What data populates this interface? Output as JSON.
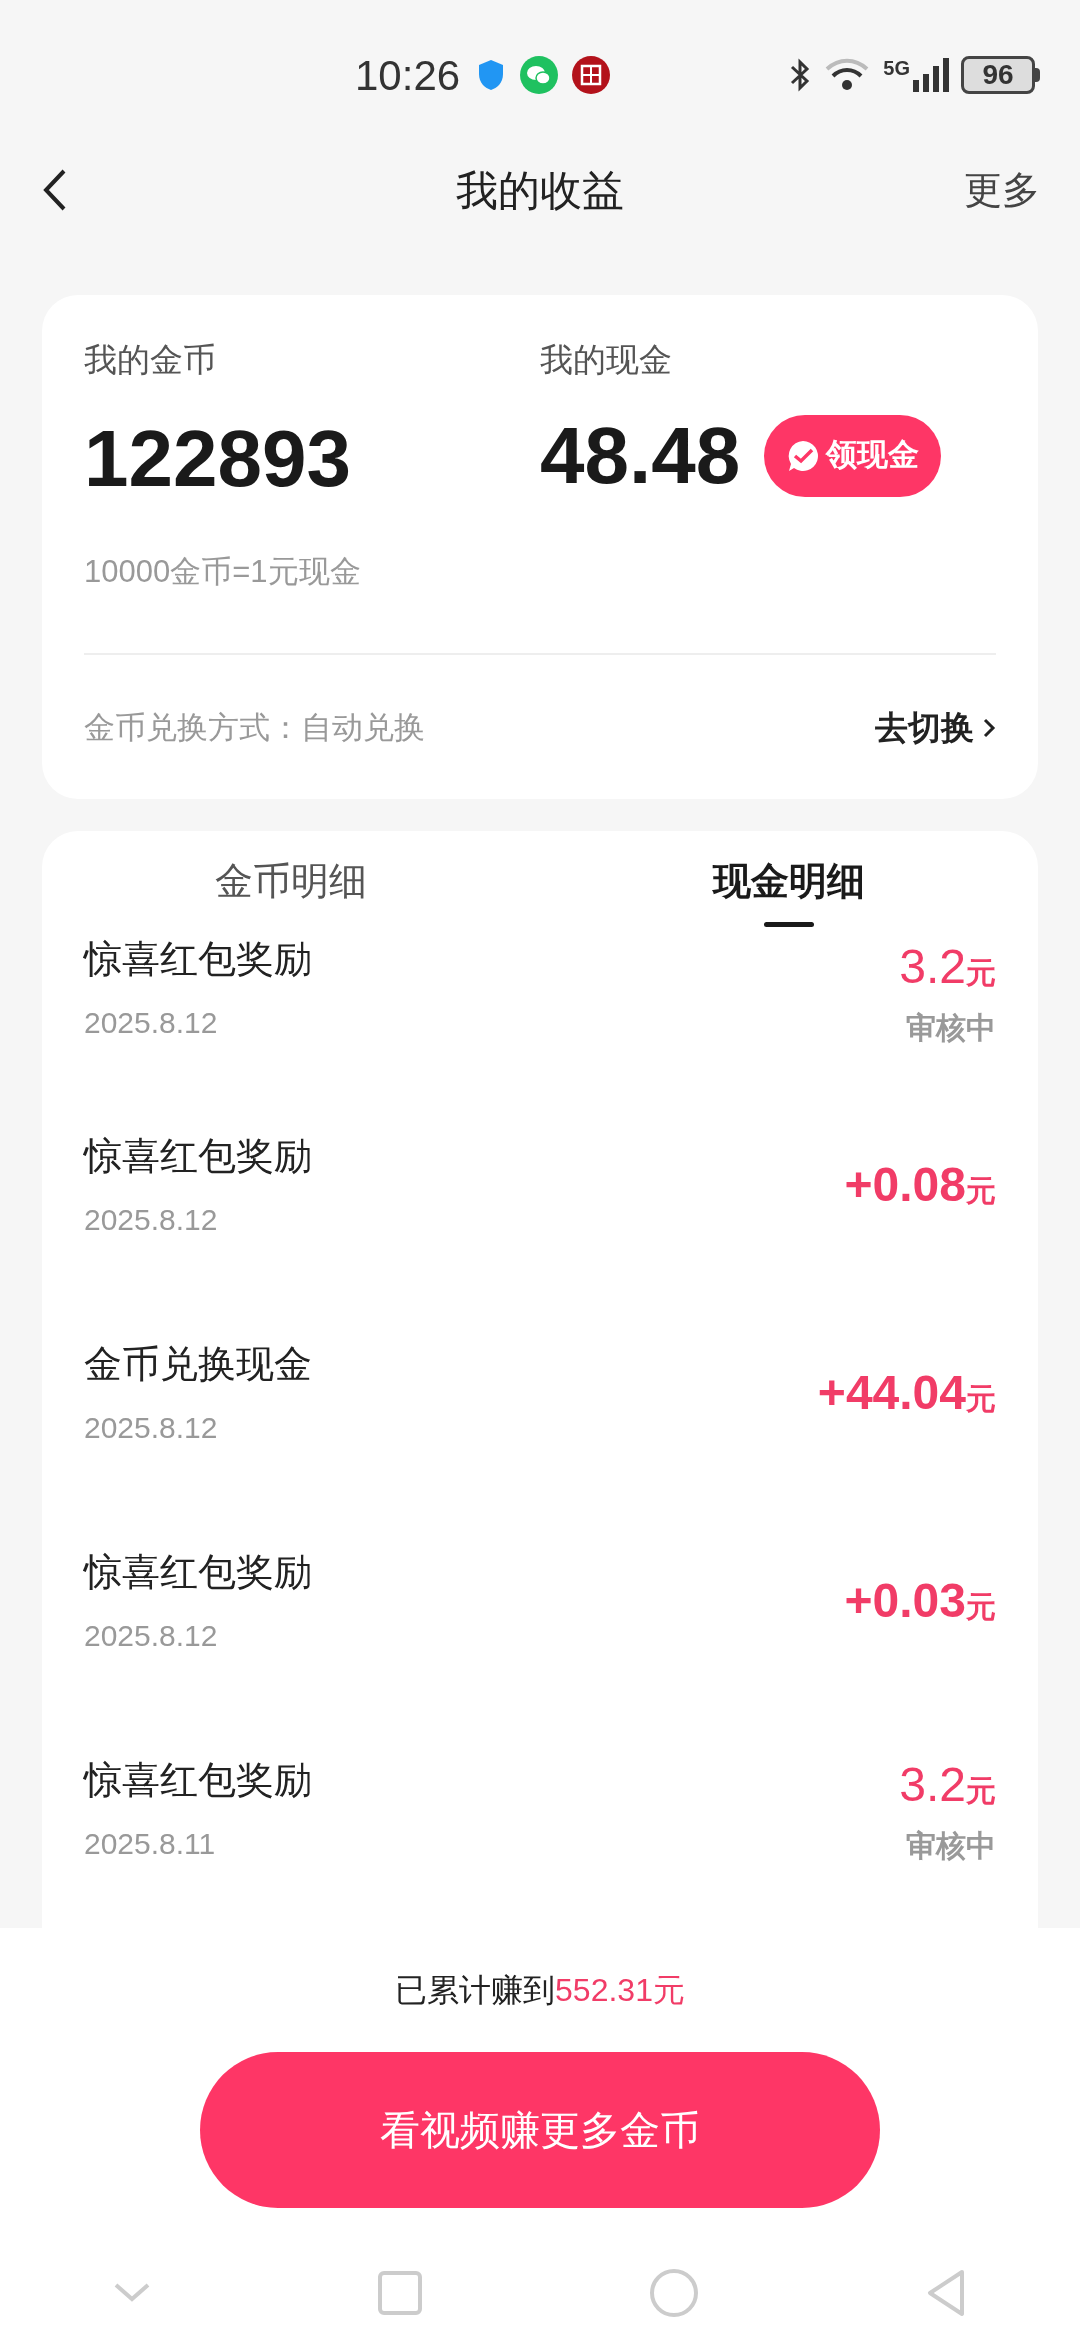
{
  "status_bar": {
    "time": "10:26",
    "battery": "96",
    "network": "5G"
  },
  "header": {
    "title": "我的收益",
    "more": "更多"
  },
  "summary_card": {
    "coins_label": "我的金币",
    "coins": "122893",
    "cash_label": "我的现金",
    "cash": "48.48",
    "withdraw_button": "领现金",
    "rate": "10000金币=1元现金",
    "exchange_label": "金币兑换方式：自动兑换",
    "switch_link": "去切换"
  },
  "tabs": [
    {
      "label": "金币明细",
      "selected": false
    },
    {
      "label": "现金明细",
      "selected": true
    }
  ],
  "records": [
    {
      "title": "惊喜红包奖励",
      "date": "2025.8.12",
      "amount": "3.2",
      "unit": "元",
      "status": "审核中"
    },
    {
      "title": "惊喜红包奖励",
      "date": "2025.8.12",
      "amount": "+0.08",
      "unit": "元"
    },
    {
      "title": "金币兑换现金",
      "date": "2025.8.12",
      "amount": "+44.04",
      "unit": "元"
    },
    {
      "title": "惊喜红包奖励",
      "date": "2025.8.12",
      "amount": "+0.03",
      "unit": "元"
    },
    {
      "title": "惊喜红包奖励",
      "date": "2025.8.11",
      "amount": "3.2",
      "unit": "元",
      "status": "审核中"
    }
  ],
  "footer": {
    "total_label": "已累计赚到",
    "total_value": "552.31元",
    "action_button": "看视频赚更多金币"
  }
}
